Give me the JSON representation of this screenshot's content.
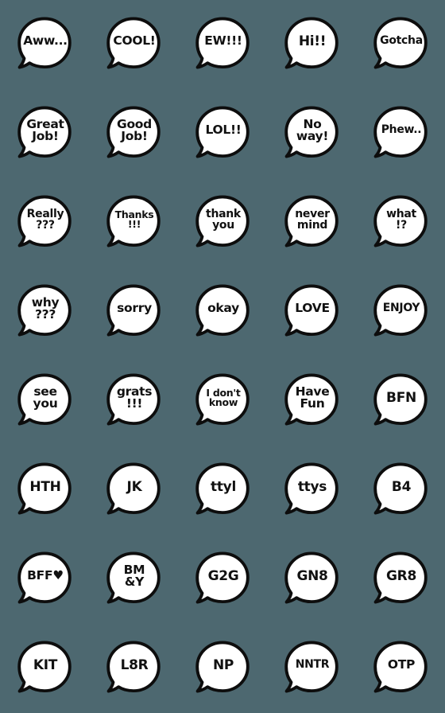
{
  "background_color": "#4d6870",
  "bubble": {
    "fill_color": "#ffffff",
    "outline_color": "#0d0d0d",
    "text_color": "#111111",
    "icon_name": "speech-bubble-icon"
  },
  "grid": {
    "columns": 5,
    "rows": 8,
    "total": 40
  },
  "stickers": [
    {
      "text": "Aww...",
      "lines": 1,
      "size": "lg"
    },
    {
      "text": "COOL!",
      "lines": 1,
      "size": "lg"
    },
    {
      "text": "EW!!!",
      "lines": 1,
      "size": "lg"
    },
    {
      "text": "Hi!!",
      "lines": 1,
      "size": "xl"
    },
    {
      "text": "Gotcha",
      "lines": 1,
      "size": "md"
    },
    {
      "text": "Great\nJob!",
      "lines": 2,
      "size": "lg"
    },
    {
      "text": "Good\nJob!",
      "lines": 2,
      "size": "lg"
    },
    {
      "text": "LOL!!",
      "lines": 1,
      "size": "lg"
    },
    {
      "text": "No\nway!",
      "lines": 2,
      "size": "lg"
    },
    {
      "text": "Phew..",
      "lines": 1,
      "size": "md"
    },
    {
      "text": "Really\n???",
      "lines": 2,
      "size": "md"
    },
    {
      "text": "Thanks\n!!!",
      "lines": 2,
      "size": "sm"
    },
    {
      "text": "thank\nyou",
      "lines": 2,
      "size": "md"
    },
    {
      "text": "never\nmind",
      "lines": 2,
      "size": "md"
    },
    {
      "text": "what\n!?",
      "lines": 2,
      "size": "md"
    },
    {
      "text": "why\n???",
      "lines": 2,
      "size": "lg"
    },
    {
      "text": "sorry",
      "lines": 1,
      "size": "lg"
    },
    {
      "text": "okay",
      "lines": 1,
      "size": "lg"
    },
    {
      "text": "LOVE",
      "lines": 1,
      "size": "lg"
    },
    {
      "text": "ENJOY",
      "lines": 1,
      "size": "md"
    },
    {
      "text": "see\nyou",
      "lines": 2,
      "size": "lg"
    },
    {
      "text": "grats\n!!!",
      "lines": 2,
      "size": "lg"
    },
    {
      "text": "I don't\nknow",
      "lines": 2,
      "size": "sm"
    },
    {
      "text": "Have\nFun",
      "lines": 2,
      "size": "lg"
    },
    {
      "text": "BFN",
      "lines": 1,
      "size": "xl"
    },
    {
      "text": "HTH",
      "lines": 1,
      "size": "xl"
    },
    {
      "text": "JK",
      "lines": 1,
      "size": "xl"
    },
    {
      "text": "ttyl",
      "lines": 1,
      "size": "xl"
    },
    {
      "text": "ttys",
      "lines": 1,
      "size": "xl"
    },
    {
      "text": "B4",
      "lines": 1,
      "size": "xl"
    },
    {
      "text": "BFF♥",
      "lines": 1,
      "size": "lg"
    },
    {
      "text": "BM\n&Y",
      "lines": 2,
      "size": "lg"
    },
    {
      "text": "G2G",
      "lines": 1,
      "size": "xl"
    },
    {
      "text": "GN8",
      "lines": 1,
      "size": "xl"
    },
    {
      "text": "GR8",
      "lines": 1,
      "size": "xl"
    },
    {
      "text": "KIT",
      "lines": 1,
      "size": "xl"
    },
    {
      "text": "L8R",
      "lines": 1,
      "size": "xl"
    },
    {
      "text": "NP",
      "lines": 1,
      "size": "xl"
    },
    {
      "text": "NNTR",
      "lines": 1,
      "size": "md"
    },
    {
      "text": "OTP",
      "lines": 1,
      "size": "lg"
    }
  ]
}
